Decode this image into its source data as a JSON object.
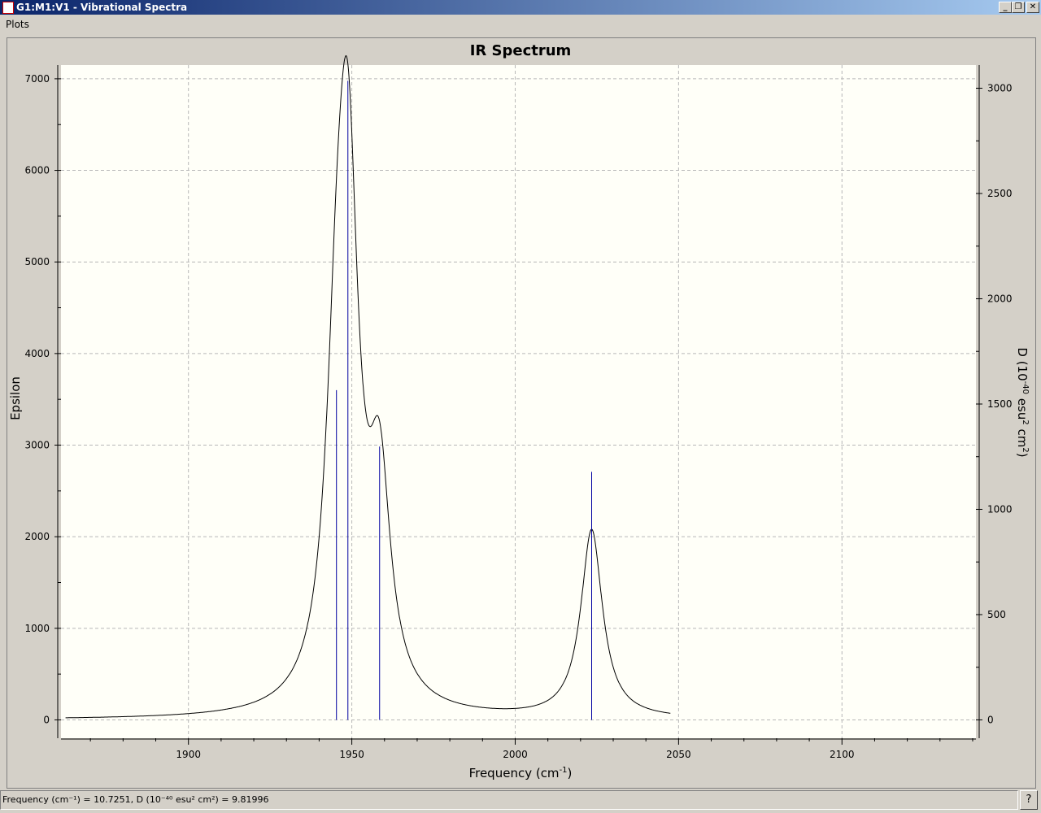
{
  "window": {
    "title": "G1:M1:V1 - Vibrational Spectra",
    "minimize": "_",
    "restore": "❐",
    "close": "✕"
  },
  "menu": {
    "plots": "Plots"
  },
  "status": {
    "text": "Frequency (cm⁻¹) = 10.7251, D (10⁻⁴⁰ esu² cm²) = 9.81996",
    "help": "?"
  },
  "chart_data": {
    "type": "line",
    "title": "IR Spectrum",
    "xlabel": "Frequency (cm-1)",
    "ylabel": "Epsilon",
    "y2label": "D (10-40 esu2 cm2)",
    "xlim": [
      1861,
      2141
    ],
    "ylim": [
      -200,
      7150
    ],
    "y2lim": [
      -87,
      3110
    ],
    "xticks": [
      1900,
      1950,
      2000,
      2050,
      2100
    ],
    "yticks": [
      0,
      1000,
      2000,
      3000,
      4000,
      5000,
      6000,
      7000
    ],
    "y2ticks": [
      0,
      500,
      1000,
      1500,
      2000,
      2500,
      3000
    ],
    "grid": true,
    "sticks": [
      {
        "freq": 1945.3,
        "D": 1566
      },
      {
        "freq": 1948.8,
        "D": 3035
      },
      {
        "freq": 1958.5,
        "D": 1298
      },
      {
        "freq": 2023.4,
        "D": 1178
      }
    ],
    "curve": {
      "from": 1862.4,
      "to": 2047.5,
      "hwhm": 4,
      "eps_per_D": 1.74
    },
    "colors": {
      "curve": "#000000",
      "sticks": "#0000a0",
      "plot_bg": "#fffff8",
      "grid": "#b8b8b8"
    }
  }
}
